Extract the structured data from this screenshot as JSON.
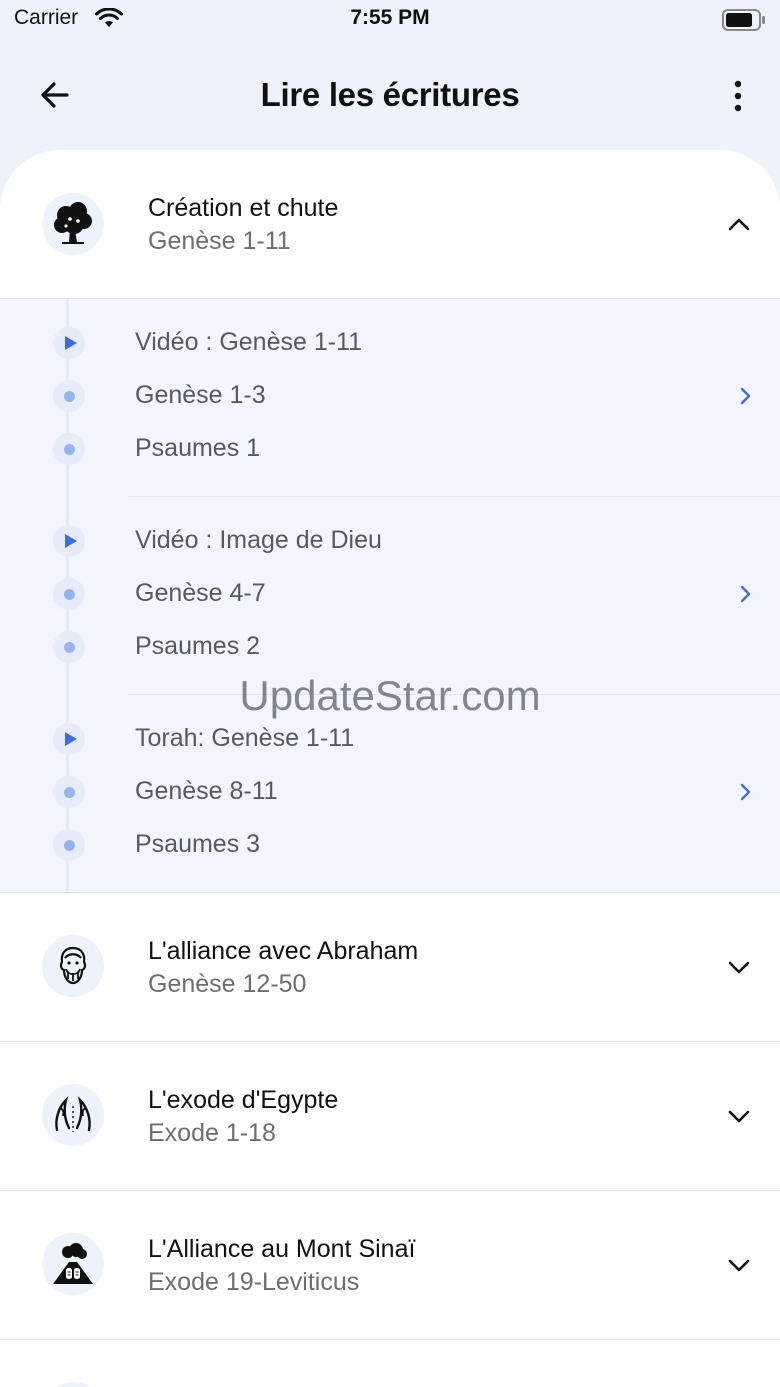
{
  "status_bar": {
    "carrier": "Carrier",
    "time": "7:55 PM"
  },
  "header": {
    "title": "Lire les écritures"
  },
  "sections": [
    {
      "title": "Création et chute",
      "subtitle": "Genèse 1-11",
      "icon": "tree-icon",
      "expanded": true
    },
    {
      "title": "L'alliance avec Abraham",
      "subtitle": "Genèse 12-50",
      "icon": "patriarch-icon",
      "expanded": false
    },
    {
      "title": "L'exode d'Egypte",
      "subtitle": "Exode 1-18",
      "icon": "parted-sea-icon",
      "expanded": false
    },
    {
      "title": "L'Alliance au Mont Sinaï",
      "subtitle": "Exode 19-Leviticus",
      "icon": "mountain-tablets-icon",
      "expanded": false
    }
  ],
  "groups": [
    {
      "items": [
        {
          "label": "Vidéo : Genèse 1-11",
          "kind": "video"
        },
        {
          "label": "Genèse 1-3",
          "kind": "reading"
        },
        {
          "label": "Psaumes 1",
          "kind": "reading"
        }
      ]
    },
    {
      "items": [
        {
          "label": "Vidéo : Image de Dieu",
          "kind": "video"
        },
        {
          "label": "Genèse 4-7",
          "kind": "reading"
        },
        {
          "label": "Psaumes 2",
          "kind": "reading"
        }
      ]
    },
    {
      "items": [
        {
          "label": "Torah: Genèse 1-11",
          "kind": "video"
        },
        {
          "label": "Genèse 8-11",
          "kind": "reading"
        },
        {
          "label": "Psaumes 3",
          "kind": "reading"
        }
      ]
    }
  ],
  "watermark": "UpdateStar.com",
  "colors": {
    "accent": "#3d6de0",
    "dot": "#98b3ef",
    "expanded_bg": "#f2f5fd"
  }
}
